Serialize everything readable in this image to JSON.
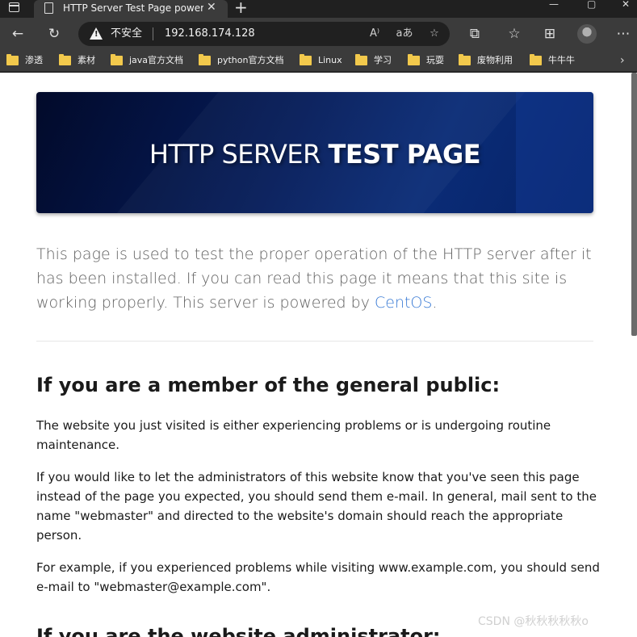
{
  "tab": {
    "title": "HTTP Server Test Page powered by CentOS"
  },
  "address": {
    "security_label": "不安全",
    "url": "192.168.174.128"
  },
  "bookmarks": [
    {
      "label": "渗透"
    },
    {
      "label": "素材"
    },
    {
      "label": "java官方文档"
    },
    {
      "label": "python官方文档"
    },
    {
      "label": "Linux"
    },
    {
      "label": "学习"
    },
    {
      "label": "玩耍"
    },
    {
      "label": "废物利用"
    },
    {
      "label": "牛牛牛"
    }
  ],
  "page": {
    "banner_plain": "HTTP SERVER ",
    "banner_bold": "TEST PAGE",
    "lead_text": "This page is used to test the proper operation of the HTTP server after it has been installed. If you can read this page it means that this site is working properly. This server is powered by ",
    "lead_link": "CentOS",
    "lead_end": ".",
    "section1_heading": "If you are a member of the general public:",
    "section1_p1": "The website you just visited is either experiencing problems or is undergoing routine maintenance.",
    "section1_p2": "If you would like to let the administrators of this website know that you've seen this page instead of the page you expected, you should send them e-mail. In general, mail sent to the name \"webmaster\" and directed to the website's domain should reach the appropriate person.",
    "section1_p3": "For example, if you experienced problems while visiting www.example.com, you should send e-mail to \"webmaster@example.com\".",
    "section2_heading": "If you are the website administrator:"
  },
  "watermark": "CSDN @秋秋秋秋秋o",
  "colors": {
    "link": "#3a7bd5",
    "banner_bg": "#051a55",
    "folder": "#f2c94c"
  }
}
